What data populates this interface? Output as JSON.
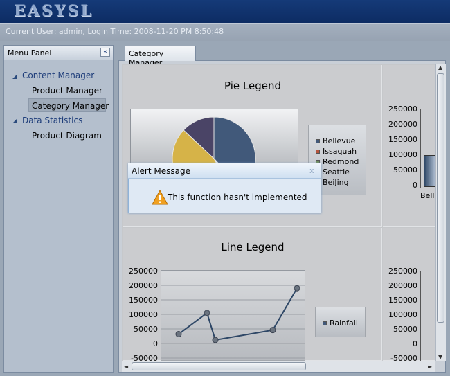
{
  "header": {
    "logo": "EASYSL"
  },
  "userbar": {
    "text": "Current User:  admin, Login Time: 2008-11-20 PM 8:50:48"
  },
  "menu": {
    "title": "Menu Panel",
    "groups": [
      {
        "label": "Content Manager",
        "items": [
          "Product Manager",
          "Category Manager"
        ]
      },
      {
        "label": "Data Statistics",
        "items": [
          "Product Diagram"
        ]
      }
    ],
    "selected": "Category Manager"
  },
  "tab": {
    "label": "Category Manager"
  },
  "pie_chart": {
    "title": "Pie Legend",
    "legend": [
      "Bellevue",
      "Issaquah",
      "Redmond",
      "Seattle",
      "BeiJing"
    ],
    "colors": {
      "Bellevue": "#41597a",
      "Issaquah": "#b4553e",
      "Redmond": "#6e8c5a",
      "Seattle": "#d6b348",
      "BeiJing": "#4a4466"
    }
  },
  "right_bar_chart": {
    "ticks": [
      "250000",
      "200000",
      "150000",
      "100000",
      "50000",
      "0"
    ],
    "category_label": "Bell"
  },
  "line_chart_block": {
    "title": "Line Legend",
    "ticks": [
      "250000",
      "200000",
      "150000",
      "100000",
      "50000",
      "0",
      "-50000"
    ],
    "right_ticks": [
      "250000",
      "200000",
      "150000",
      "100000",
      "50000",
      "0",
      "-50000"
    ]
  },
  "chart_data": [
    {
      "type": "pie",
      "title": "Pie Legend",
      "categories": [
        "Bellevue",
        "Issaquah",
        "Redmond",
        "Seattle",
        "BeiJing"
      ],
      "values": [
        38,
        2,
        2,
        45,
        13
      ],
      "legend_position": "right"
    },
    {
      "type": "line",
      "title": "Line Legend",
      "x": [
        1,
        2,
        3,
        4,
        5
      ],
      "series": [
        {
          "name": "Rainfall",
          "values": [
            32000,
            105000,
            12000,
            46000,
            190000
          ]
        }
      ],
      "ylim": [
        -50000,
        250000
      ],
      "yticks": [
        250000,
        200000,
        150000,
        100000,
        50000,
        0,
        -50000
      ],
      "legend_position": "right"
    }
  ],
  "scrollbars": {
    "vertical_up": "▲",
    "vertical_down": "▼",
    "horizontal_left": "◄",
    "horizontal_right": "►"
  },
  "alert": {
    "title": "Alert Message",
    "close": "x",
    "message": "This function hasn't implemented"
  }
}
